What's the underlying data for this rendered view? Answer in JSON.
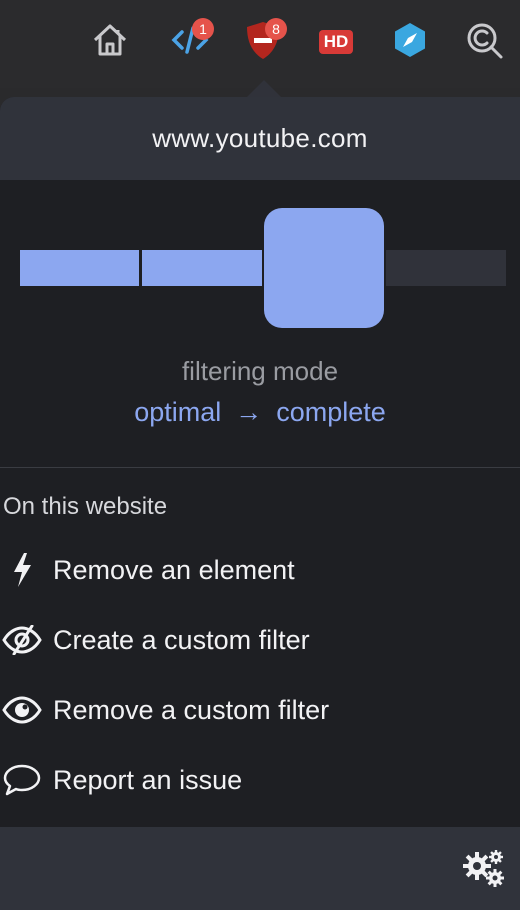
{
  "toolbar": {
    "buttons": [
      {
        "name": "home-icon"
      },
      {
        "name": "code-icon",
        "badge": "1"
      },
      {
        "name": "ublock-shield-icon",
        "badge": "8"
      },
      {
        "name": "hd-icon",
        "label": "HD"
      },
      {
        "name": "compass-icon"
      },
      {
        "name": "search-icon"
      }
    ]
  },
  "popup": {
    "hostname": "www.youtube.com",
    "filtering": {
      "label": "filtering mode",
      "from": "optimal",
      "arrow": "→",
      "to": "complete",
      "level": 3,
      "levels": 4
    },
    "section_title": "On this website",
    "menu": [
      {
        "icon": "lightning-icon",
        "label": "Remove an element"
      },
      {
        "icon": "eye-slash-icon",
        "label": "Create a custom filter"
      },
      {
        "icon": "eye-icon",
        "label": "Remove a custom filter"
      },
      {
        "icon": "speech-bubble-icon",
        "label": "Report an issue"
      }
    ]
  },
  "colors": {
    "accent": "#8ca7f0",
    "badge": "#e5534b",
    "shield": "#b3261e",
    "compass": "#3aa7e0"
  }
}
